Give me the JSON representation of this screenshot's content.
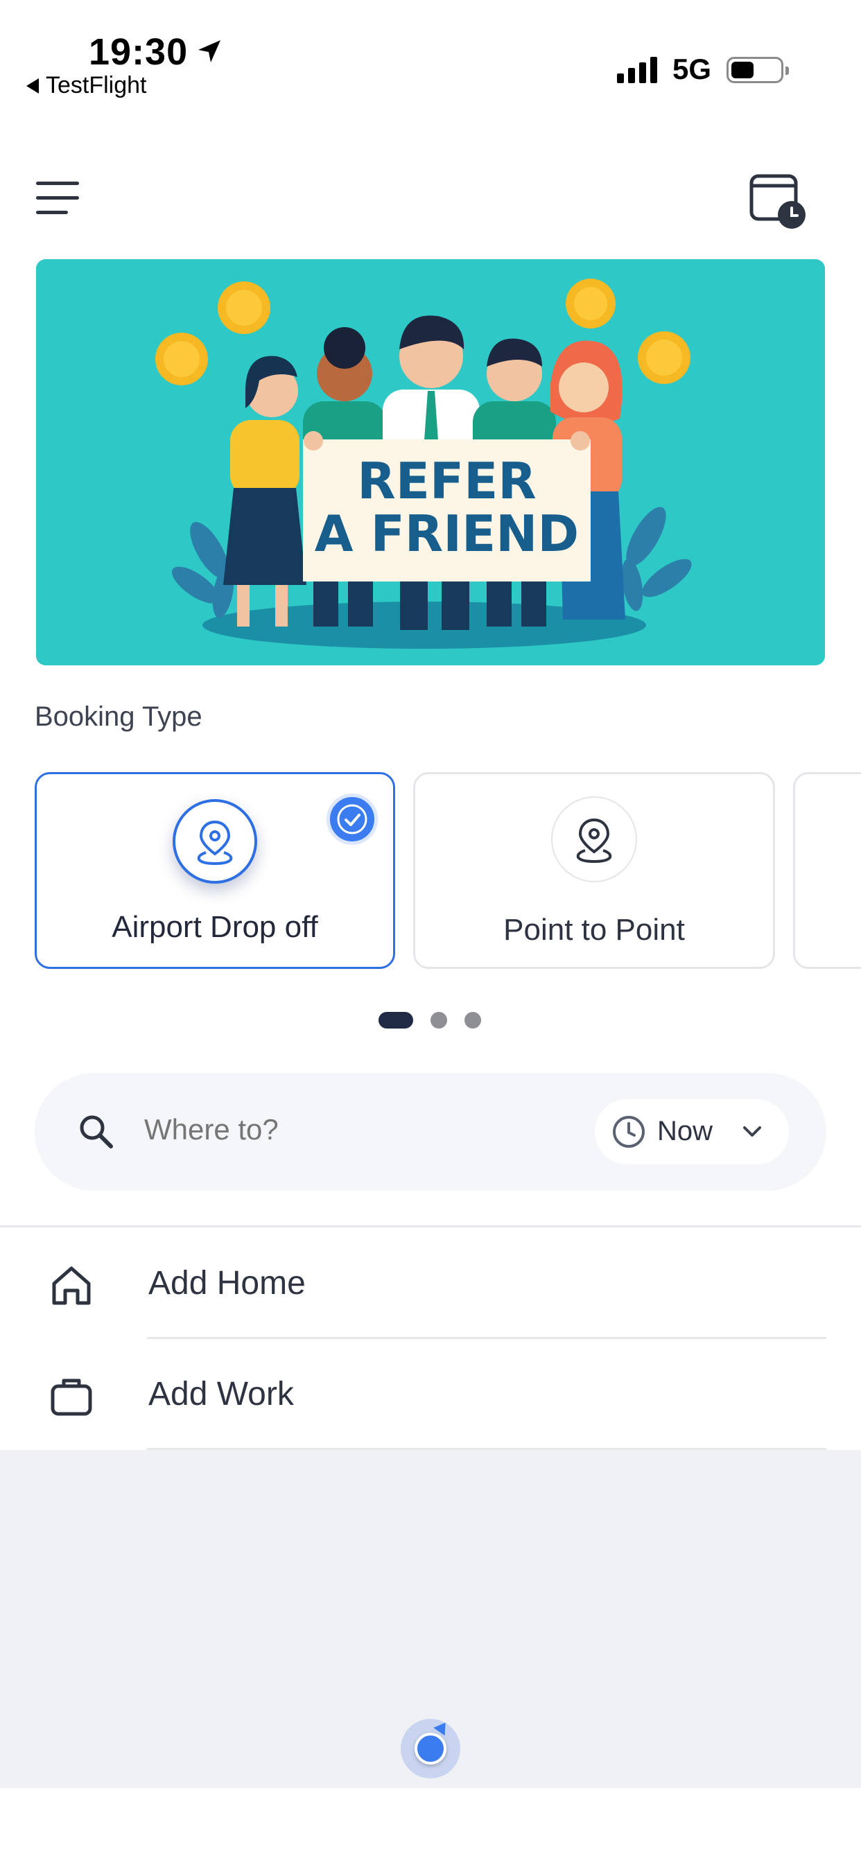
{
  "status_bar": {
    "time": "19:30",
    "back_app": "TestFlight",
    "network": "5G",
    "battery_level": 0.35,
    "location_icon": "location-arrow-icon"
  },
  "header": {
    "menu_icon": "hamburger-menu-icon",
    "schedule_icon": "calendar-clock-icon"
  },
  "banner": {
    "headline_line1": "REFER",
    "headline_line2": "A FRIEND",
    "background": "#2ec8c6"
  },
  "booking": {
    "section_label": "Booking Type",
    "types": [
      {
        "label": "Airport Drop off",
        "icon": "map-pin-icon",
        "selected": true
      },
      {
        "label": "Point to Point",
        "icon": "map-pin-icon",
        "selected": false
      }
    ],
    "pager": {
      "pages": 3,
      "active": 0
    }
  },
  "search": {
    "placeholder": "Where to?",
    "time_label": "Now"
  },
  "saved_places": [
    {
      "label": "Add Home",
      "icon": "home-icon"
    },
    {
      "label": "Add Work",
      "icon": "briefcase-icon"
    }
  ],
  "colors": {
    "accent": "#2f6fe4",
    "check": "#3b7cf0",
    "pager_active": "#1f2a44"
  }
}
